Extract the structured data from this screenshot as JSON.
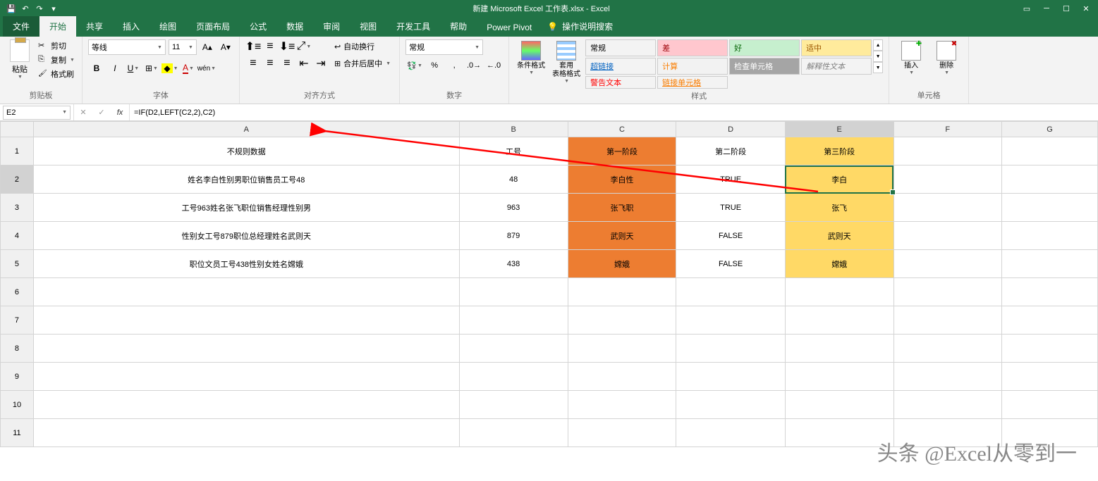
{
  "title": "新建 Microsoft Excel 工作表.xlsx - Excel",
  "tabs": {
    "file": "文件",
    "home": "开始",
    "share": "共享",
    "insert": "插入",
    "draw": "绘图",
    "page_layout": "页面布局",
    "formulas": "公式",
    "data": "数据",
    "review": "审阅",
    "view": "视图",
    "developer": "开发工具",
    "help": "帮助",
    "powerpivot": "Power Pivot"
  },
  "tell_me": "操作说明搜索",
  "ribbon": {
    "clipboard": {
      "paste": "粘贴",
      "cut": "剪切",
      "copy": "复制",
      "painter": "格式刷",
      "label": "剪贴板"
    },
    "font": {
      "name": "等线",
      "size": "11",
      "label": "字体"
    },
    "alignment": {
      "wrap": "自动换行",
      "merge": "合并后居中",
      "label": "对齐方式"
    },
    "number": {
      "format": "常规",
      "label": "数字"
    },
    "styles": {
      "cond_format": "条件格式",
      "table_format": "套用\n表格格式",
      "normal": "常规",
      "bad": "差",
      "good": "好",
      "neutral": "适中",
      "hyperlink": "超链接",
      "calc": "计算",
      "check": "检查单元格",
      "explain": "解释性文本",
      "warning": "警告文本",
      "linked": "链接单元格",
      "label": "样式"
    },
    "cells": {
      "insert": "插入",
      "delete": "删除",
      "label": "单元格"
    }
  },
  "name_box": "E2",
  "formula": "=IF(D2,LEFT(C2,2),C2)",
  "columns": [
    "A",
    "B",
    "C",
    "D",
    "E",
    "F",
    "G"
  ],
  "row_numbers": [
    "1",
    "2",
    "3",
    "4",
    "5",
    "6",
    "7",
    "8",
    "9",
    "10",
    "11"
  ],
  "sheet": {
    "headers": {
      "A": "不规则数据",
      "B": "工号",
      "C": "第一阶段",
      "D": "第二阶段",
      "E": "第三阶段"
    },
    "rows": [
      {
        "A": "姓名李白性别男职位销售员工号48",
        "B": "48",
        "C": "李白性",
        "D": "TRUE",
        "E": "李白"
      },
      {
        "A": "工号963姓名张飞职位销售经理性别男",
        "B": "963",
        "C": "张飞职",
        "D": "TRUE",
        "E": "张飞"
      },
      {
        "A": "性别女工号879职位总经理姓名武则天",
        "B": "879",
        "C": "武则天",
        "D": "FALSE",
        "E": "武则天"
      },
      {
        "A": "职位文员工号438性别女姓名嫦娥",
        "B": "438",
        "C": "嫦娥",
        "D": "FALSE",
        "E": "嫦娥"
      }
    ]
  },
  "watermark": "头条 @Excel从零到一"
}
